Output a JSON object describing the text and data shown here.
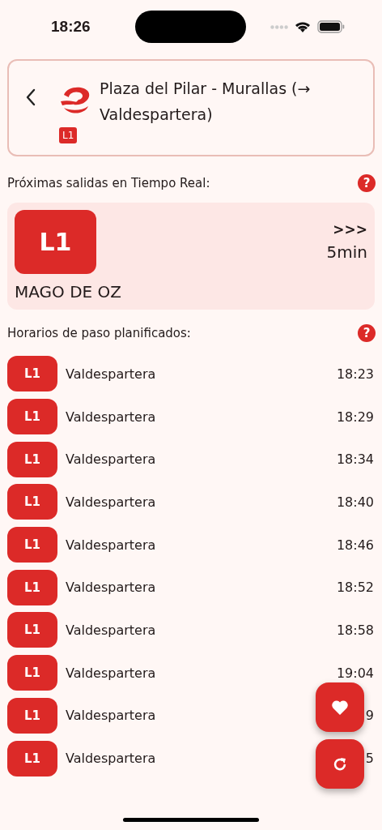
{
  "status_bar": {
    "time": "18:26"
  },
  "header": {
    "title": "Plaza del Pilar - Murallas (→ Valdespartera)",
    "line_badge": "L1"
  },
  "realtime": {
    "label": "Próximas salidas en Tiempo Real:",
    "help": "?",
    "departures": [
      {
        "line": "L1",
        "destination": "MAGO DE OZ",
        "indicator": ">>>",
        "eta": "5min"
      }
    ]
  },
  "schedule": {
    "label": "Horarios de paso planificados:",
    "help": "?",
    "rows": [
      {
        "line": "L1",
        "destination": "Valdespartera",
        "time": "18:23"
      },
      {
        "line": "L1",
        "destination": "Valdespartera",
        "time": "18:29"
      },
      {
        "line": "L1",
        "destination": "Valdespartera",
        "time": "18:34"
      },
      {
        "line": "L1",
        "destination": "Valdespartera",
        "time": "18:40"
      },
      {
        "line": "L1",
        "destination": "Valdespartera",
        "time": "18:46"
      },
      {
        "line": "L1",
        "destination": "Valdespartera",
        "time": "18:52"
      },
      {
        "line": "L1",
        "destination": "Valdespartera",
        "time": "18:58"
      },
      {
        "line": "L1",
        "destination": "Valdespartera",
        "time": "19:04"
      },
      {
        "line": "L1",
        "destination": "Valdespartera",
        "time": "9"
      },
      {
        "line": "L1",
        "destination": "Valdespartera",
        "time": "5"
      }
    ]
  }
}
